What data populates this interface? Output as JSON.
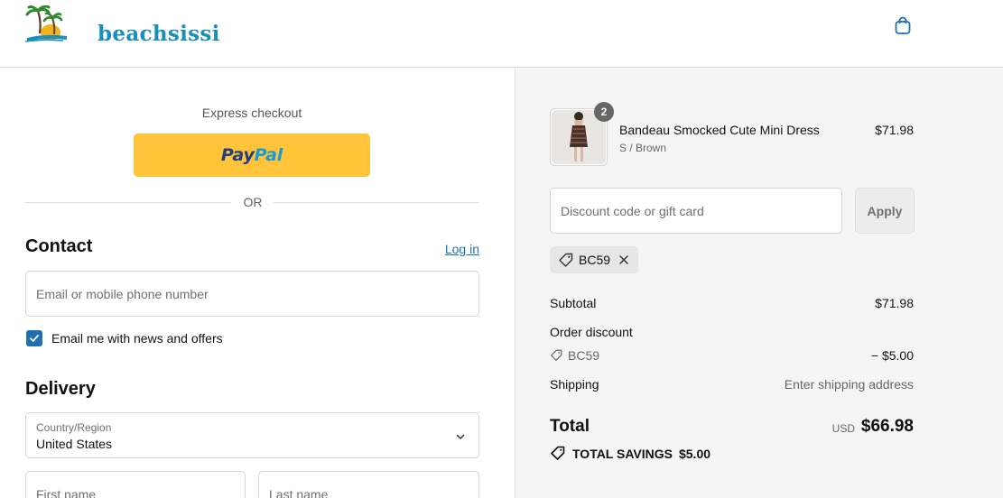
{
  "header": {
    "brand": "beachsissi",
    "cart_icon": "shopping-bag-icon"
  },
  "express": {
    "label": "Express checkout",
    "paypal_part1": "Pay",
    "paypal_part2": "Pal",
    "divider": "OR"
  },
  "contact": {
    "title": "Contact",
    "login_label": "Log in",
    "email_placeholder": "Email or mobile phone number",
    "newsletter_label": "Email me with news and offers",
    "newsletter_checked": true
  },
  "delivery": {
    "title": "Delivery",
    "country_label": "Country/Region",
    "country_value": "United States",
    "first_name_placeholder": "First name",
    "last_name_placeholder": "Last name"
  },
  "order": {
    "item": {
      "name": "Bandeau Smocked Cute Mini Dress",
      "variant": "S / Brown",
      "price": "$71.98",
      "quantity": "2"
    },
    "discount_placeholder": "Discount code or gift card",
    "apply_label": "Apply",
    "applied_code": "BC59",
    "subtotal_label": "Subtotal",
    "subtotal_value": "$71.98",
    "order_discount_label": "Order discount",
    "discount_code": "BC59",
    "discount_value": "− $5.00",
    "shipping_label": "Shipping",
    "shipping_value": "Enter shipping address",
    "total_label": "Total",
    "currency": "USD",
    "total_value": "$66.98",
    "savings_label": "TOTAL SAVINGS",
    "savings_value": "$5.00"
  },
  "colors": {
    "accent": "#1f6fb2",
    "paypal_yellow": "#ffc439",
    "summary_bg": "#f5f5f5"
  }
}
